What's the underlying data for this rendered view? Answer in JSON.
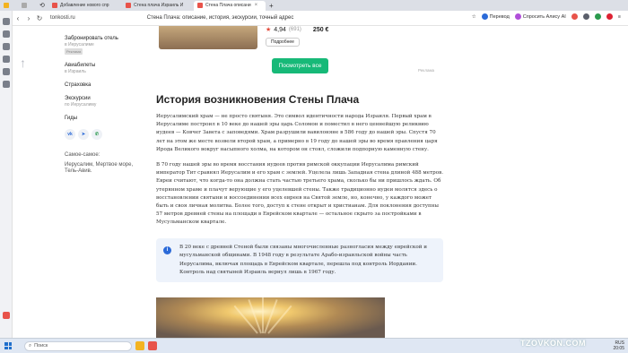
{
  "browser": {
    "tabs": [
      {
        "label": "Добавление нового спр"
      },
      {
        "label": "Стена плача Израиль И"
      },
      {
        "label": "Стена Плача описани"
      }
    ],
    "url_host": "tonkosti.ru",
    "page_title": "Стена Плача: описание, история, экскурсии, точный адрес",
    "translate_label": "Перевод",
    "alice_label": "Спросить Алису AI",
    "yandex_logo": "Яндекс"
  },
  "sidebar": {
    "items": [
      {
        "label": "Забронировать отель",
        "sub": "в Иерусалиме",
        "badge": "Реклама"
      },
      {
        "label": "Авиабилеты",
        "sub": "в Израиль"
      },
      {
        "label": "Страховка",
        "sub": ""
      },
      {
        "label": "Экскурсии",
        "sub": "по Иерусалиму"
      },
      {
        "label": "Гиды",
        "sub": ""
      }
    ],
    "socials": [
      "vk",
      "tg",
      "wa"
    ],
    "recent_title": "Самое-самое:",
    "recent_text": "Иерусалим, Мертвое море, Тель-Авив."
  },
  "hotel": {
    "rating": "4,94",
    "reviews": "(691)",
    "price": "250 €",
    "details_label": "Подробнее",
    "see_all_label": "Посмотреть все",
    "ads_label": "Реклама"
  },
  "article": {
    "heading": "История возникновения Стены Плача",
    "p1": "Иерусалимский храм — не просто святыня. Это символ идентичности народа Израиля. Первый храм в Иерусалиме построил в 10 веке до нашей эры царь Соломон и поместил в него ценнейшую реликвию иудеев — Ковчег Завета с заповедями. Храм разрушили вавилоняне в 586 году до нашей эры. Спустя 70 лет на этом же месте возвели второй храм, а примерно в 19 году до нашей эры во время правления царя Ирода Великого вокруг насыпного холма, на котором он стоял, сложили подпорную каменную стену.",
    "p2": "В 70 году нашей эры во время восстания иудеев против римской оккупации Иерусалима римский император Тит сравнял Иерусалим и его храм с землей. Уцелела лишь Западная стена длиной 488 метров. Евреи считают, что когда-то она должна стать частью третьего храма, сколько бы ни пришлось ждать. Об утерянном храме и плачут верующие у его уцелевшей стены. Также традиционно иудеи молятся здесь о восстановлении святыни и воссоединении всех евреев на Святой земле, но, конечно, у каждого может быть и своя личная молитва. Более того, доступ к стене открыт и христианам. Для поклонения доступны 57 метров древней стены на площади в Еврейском квартале — остальное скрыто за постройками в Мусульманском квартале.",
    "note": "В 20 веке с древней Стеной были связаны многочисленные разногласия между еврейской и мусульманской общинами. В 1948 году в результате Арабо-израильской войны часть Иерусалима, включая площадь в Еврейском квартале, перешла под контроль Иордании. Контроль над святыней Израиль вернул лишь в 1967 году."
  },
  "taskbar": {
    "search_placeholder": "Поиск",
    "tray_line1": "RUS",
    "tray_line2": "20:05",
    "watermark": "TZOVKON.COM"
  },
  "colors": {
    "accent_green": "#17b978",
    "link_blue": "#2b6ad8",
    "note_bg": "#eef3fb"
  }
}
